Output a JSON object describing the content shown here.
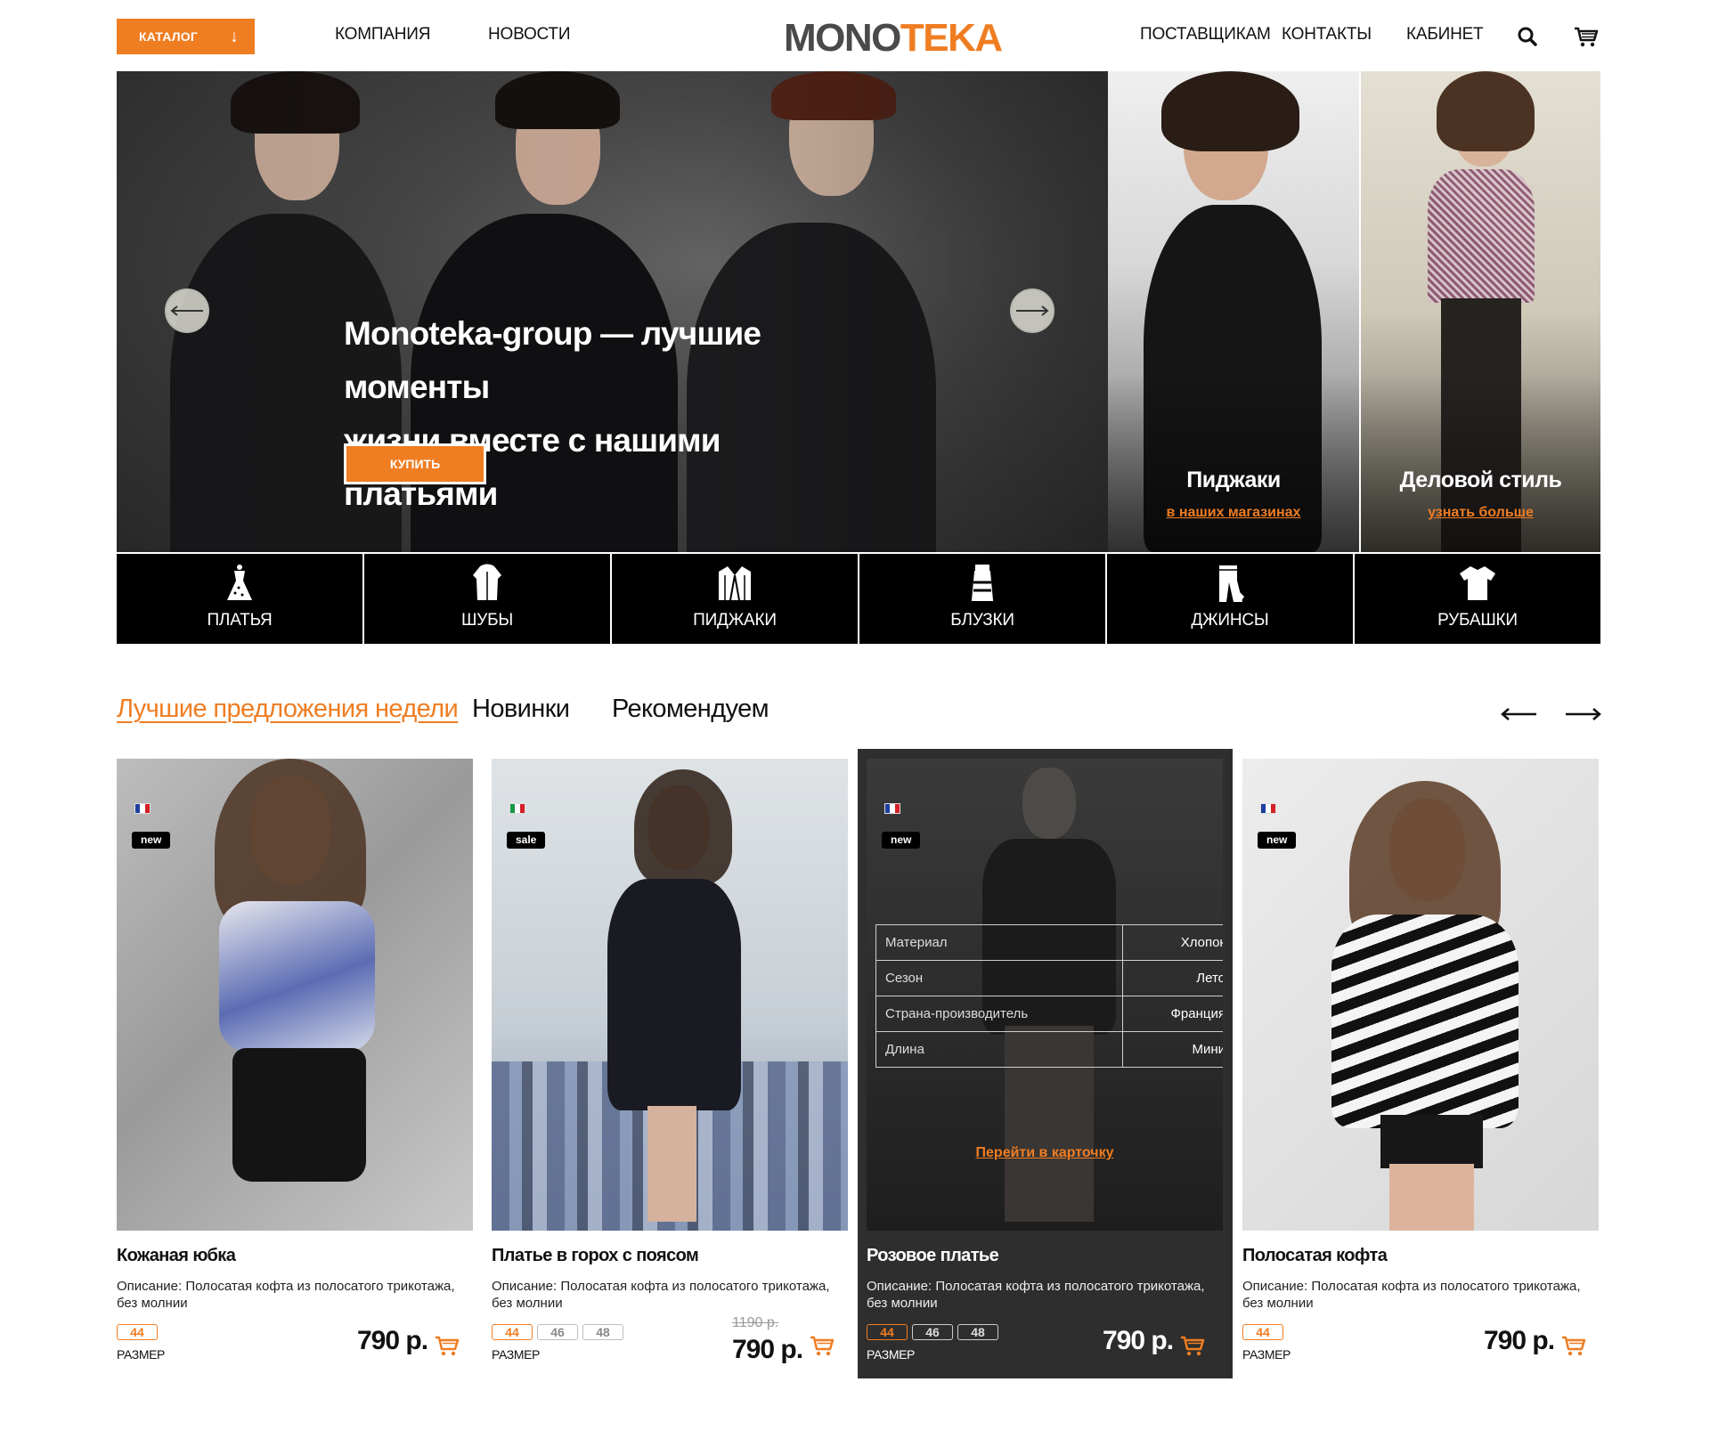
{
  "header": {
    "catalog_label": "КАТАЛОГ",
    "nav_left": [
      "КОМПАНИЯ",
      "НОВОСТИ"
    ],
    "logo_part1": "MONO",
    "logo_part2": "TEKA",
    "nav_right": [
      "ПОСТАВЩИКАМ",
      "КОНТАКТЫ",
      "КАБИНЕТ"
    ],
    "icons": [
      "search-icon",
      "cart-icon"
    ]
  },
  "hero": {
    "title_line1": "Monoteka-group — лучшие моменты",
    "title_line2": "жизни вместе с нашими платьями",
    "buy_label": "КУПИТЬ"
  },
  "promos": [
    {
      "title": "Пиджаки",
      "link": "в наших магазинах"
    },
    {
      "title": "Деловой стиль",
      "link": "узнать больше"
    }
  ],
  "categories": [
    {
      "label": "ПЛАТЬЯ",
      "icon": "dress-icon"
    },
    {
      "label": "ШУБЫ",
      "icon": "fur-coat-icon"
    },
    {
      "label": "ПИДЖАКИ",
      "icon": "jacket-icon"
    },
    {
      "label": "БЛУЗКИ",
      "icon": "blouse-icon"
    },
    {
      "label": "ДЖИНСЫ",
      "icon": "jeans-icon"
    },
    {
      "label": "РУБАШКИ",
      "icon": "shirt-icon"
    }
  ],
  "tabs": [
    "Лучшие предложения недели",
    "Новинки",
    "Рекомендуем"
  ],
  "products": [
    {
      "name": "Кожаная юбка",
      "desc": "Описание: Полосатая кофта из полосатого трикотажа, без молнии",
      "badge": "new",
      "flag": "france",
      "sizes": [
        "44"
      ],
      "size_label": "РАЗМЕР",
      "price": "790 р.",
      "old_price": ""
    },
    {
      "name": "Платье в горох с поясом",
      "desc": "Описание: Полосатая кофта из полосатого трикотажа, без молнии",
      "badge": "sale",
      "flag": "italy",
      "sizes": [
        "44",
        "46",
        "48"
      ],
      "size_label": "РАЗМЕР",
      "price": "790 р.",
      "old_price": "1190 р."
    },
    {
      "name": "Розовое платье",
      "desc": "Описание: Полосатая кофта из полосатого трикотажа, без молнии",
      "badge": "new",
      "flag": "france",
      "sizes": [
        "44",
        "46",
        "48"
      ],
      "size_label": "РАЗМЕР",
      "price": "790 р.",
      "old_price": "",
      "specs": [
        {
          "k": "Материал",
          "v": "Хлопок"
        },
        {
          "k": "Сезон",
          "v": "Лето"
        },
        {
          "k": "Страна-производитель",
          "v": "Франция"
        },
        {
          "k": "Длина",
          "v": "Мини"
        }
      ],
      "goto_label": "Перейти в карточку"
    },
    {
      "name": "Полосатая кофта",
      "desc": "Описание: Полосатая кофта из полосатого трикотажа, без молнии",
      "badge": "new",
      "flag": "france",
      "sizes": [
        "44"
      ],
      "size_label": "РАЗМЕР",
      "price": "790 р.",
      "old_price": ""
    }
  ],
  "colors": {
    "accent": "#ef7d22",
    "dark_card": "#2e2e2e",
    "strip": "#000000"
  }
}
